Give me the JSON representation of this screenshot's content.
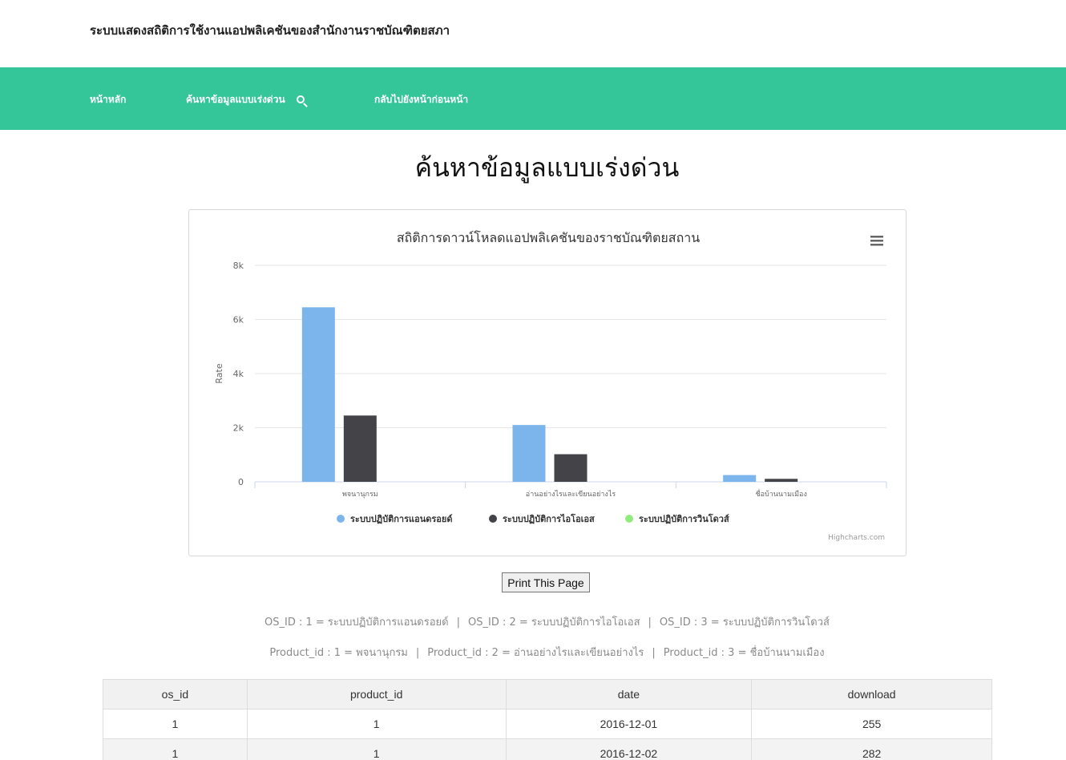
{
  "site": {
    "title": "ระบบแสดงสถิติการใช้งานแอปพลิเคชันของสำนักงานราชบัณฑิตยสภา"
  },
  "nav": {
    "home": "หน้าหลัก",
    "search": "ค้นหาข้อมูลแบบเร่งด่วน",
    "back": "กลับไปยังหน้าก่อนหน้า"
  },
  "page": {
    "title": "ค้นหาข้อมูลแบบเร่งด่วน"
  },
  "chart_data": {
    "type": "bar",
    "title": "สถิติการดาวน์โหลดแอปพลิเคชันของราชบัณฑิตยสถาน",
    "ylabel": "Rate",
    "xlabel": "",
    "ylim": [
      0,
      8000
    ],
    "yticks": [
      "0",
      "2k",
      "4k",
      "6k",
      "8k"
    ],
    "grid": true,
    "legend_position": "bottom",
    "categories": [
      "พจนานุกรม",
      "อ่านอย่างไรและเขียนอย่างไร",
      "ชื่อบ้านนามเมือง"
    ],
    "series": [
      {
        "name": "ระบบปฏิบัติการแอนดรอยด์",
        "color": "#7cb5ec",
        "values": [
          6450,
          2100,
          250
        ]
      },
      {
        "name": "ระบบปฏิบัติการไอโอเอส",
        "color": "#434348",
        "values": [
          2450,
          1020,
          110
        ]
      },
      {
        "name": "ระบบปฏิบัติการวินโดวส์",
        "color": "#90ed7d",
        "values": [
          0,
          0,
          0
        ]
      }
    ],
    "credits": "Highcharts.com",
    "menu_icon": "hamburger-menu-icon"
  },
  "print_button": "Print This Page",
  "legend_os": [
    "OS_ID : 1 = ระบบปฏิบัติการแอนดรอยด์",
    "OS_ID : 2 = ระบบปฏิบัติการไอโอเอส",
    "OS_ID : 3 = ระบบปฏิบัติการวินโดวส์"
  ],
  "legend_product": [
    "Product_id : 1 = พจนานุกรม",
    "Product_id : 2 = อ่านอย่างไรและเขียนอย่างไร",
    "Product_id : 3 = ชื่อบ้านนามเมือง"
  ],
  "table": {
    "headers": [
      "os_id",
      "product_id",
      "date",
      "download"
    ],
    "rows": [
      [
        "1",
        "1",
        "2016-12-01",
        "255"
      ],
      [
        "1",
        "1",
        "2016-12-02",
        "282"
      ]
    ]
  }
}
